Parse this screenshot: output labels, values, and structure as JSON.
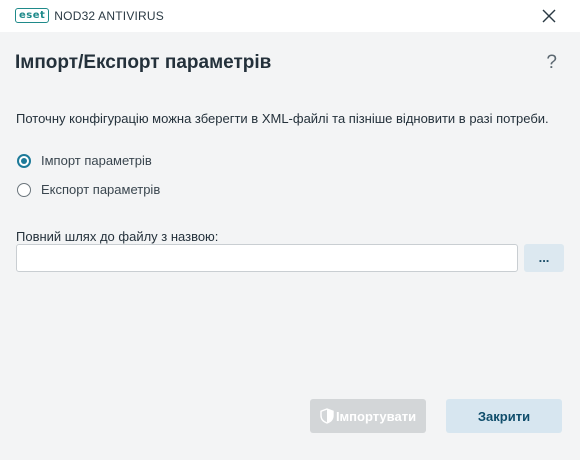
{
  "titlebar": {
    "logo_text": "eset",
    "app_name": "NOD32 ANTIVIRUS"
  },
  "dialog": {
    "title": "Імпорт/Експорт параметрів",
    "help_label": "?",
    "description": "Поточну конфігурацію можна зберегти в XML-файлі та пізніше відновити в разі потреби.",
    "options": [
      {
        "label": "Імпорт параметрів",
        "checked": true
      },
      {
        "label": "Експорт параметрів",
        "checked": false
      }
    ],
    "path_label": "Повний шлях до файлу з назвою:",
    "path_value": "",
    "browse_label": "...",
    "import_label": "Імпортувати",
    "close_label": "Закрити"
  },
  "colors": {
    "accent": "#1d7a99",
    "brand": "#1f8a8a",
    "background": "#f3f4f5",
    "disabled_button": "#d3d6d8",
    "secondary_button": "#d7e6f0"
  },
  "icons": {
    "close": "close-icon",
    "shield": "shield-icon"
  }
}
